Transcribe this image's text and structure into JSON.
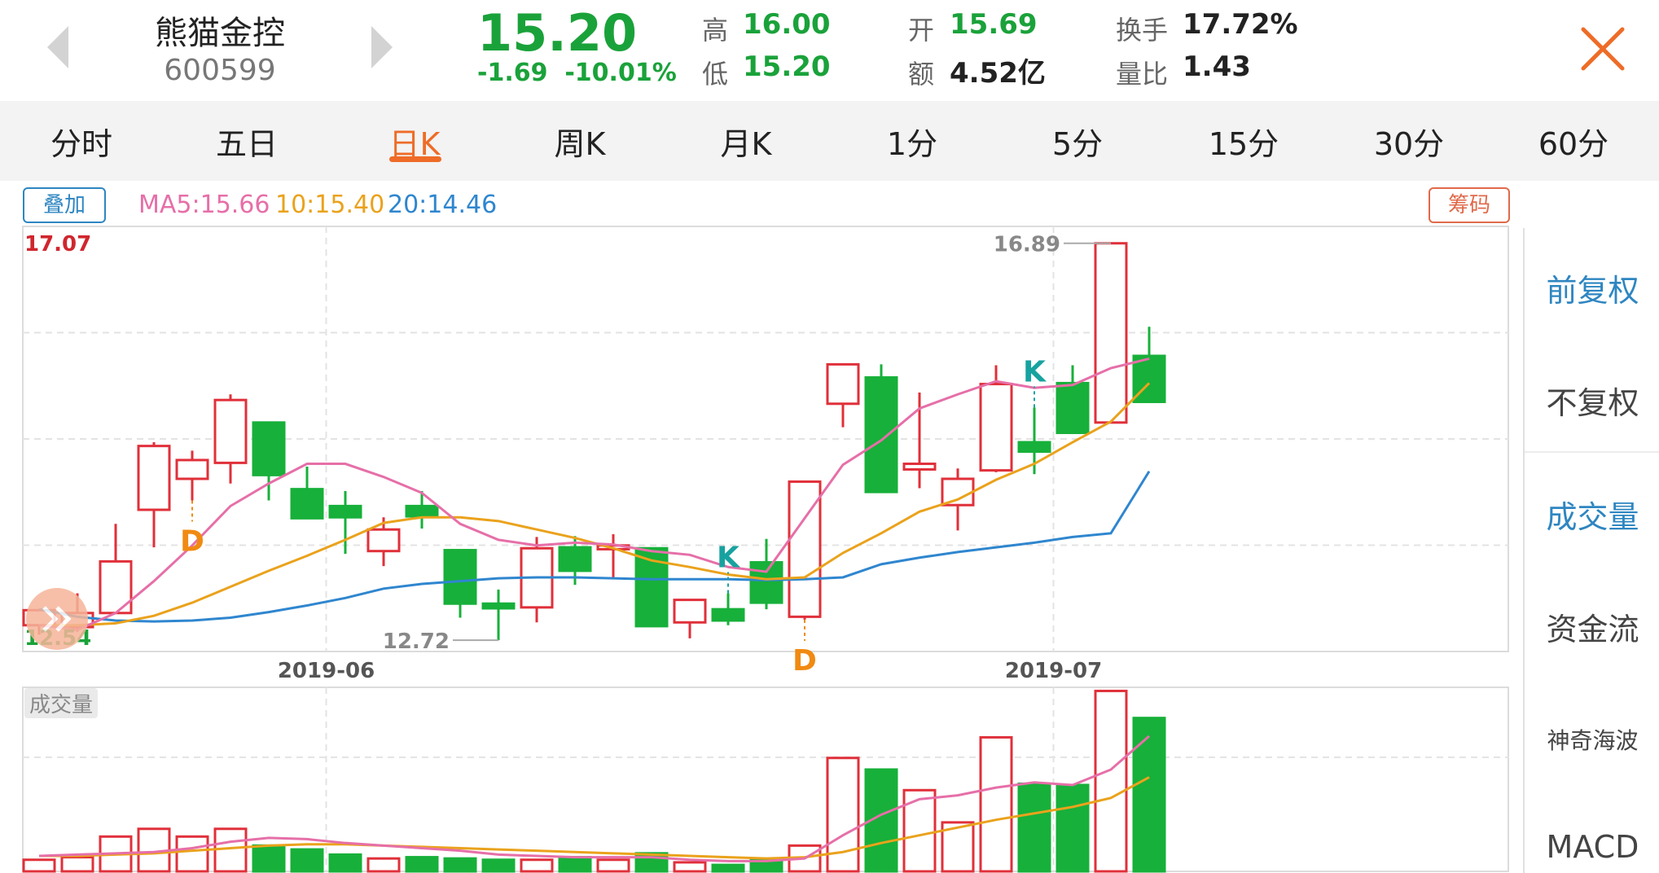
{
  "header": {
    "name": "熊猫金控",
    "code": "600599",
    "price": "15.20",
    "change": "-1.69  -10.01%",
    "quotes": {
      "high_label": "高",
      "high": "16.00",
      "low_label": "低",
      "low": "15.20",
      "open_label": "开",
      "open": "15.69",
      "amount_label": "额",
      "amount": "4.52亿",
      "turnover_label": "换手",
      "turnover": "17.72%",
      "vol_ratio_label": "量比",
      "vol_ratio": "1.43"
    }
  },
  "tabs": [
    "分时",
    "五日",
    "日K",
    "周K",
    "月K",
    "1分",
    "5分",
    "15分",
    "30分",
    "60分"
  ],
  "active_tab": "日K",
  "toolbar": {
    "overlay_label": "叠加",
    "ma5": "MA5:15.66",
    "ma10": "10:15.40",
    "ma20": "20:14.46",
    "chips_label": "筹码"
  },
  "side_panel": [
    "前复权",
    "不复权",
    "成交量",
    "资金流",
    "神奇海波",
    "MACD"
  ],
  "colors": {
    "up": "#e0303a",
    "down": "#17b03a",
    "ma5": "#e66fa8",
    "ma10": "#eaa21c",
    "ma20": "#2f86cf",
    "accent": "#ee6c27",
    "signal_d": "#f08a12",
    "signal_k": "#17a2a0"
  },
  "chart_data": {
    "type": "candlestick",
    "axis_top": "17.07",
    "axis_bottom": "12.54",
    "ylim": [
      12.54,
      17.07
    ],
    "date_labels": [
      "2019-06",
      "2019-07"
    ],
    "date_label_index": [
      8,
      27
    ],
    "max_label": "16.89",
    "min_label": "12.72",
    "volume_label": "成交量",
    "candles": [
      {
        "o": 12.82,
        "h": 12.92,
        "l": 12.72,
        "c": 12.98
      },
      {
        "o": 12.8,
        "h": 13.16,
        "l": 12.75,
        "c": 12.95
      },
      {
        "o": 12.95,
        "h": 13.9,
        "l": 12.95,
        "c": 13.5
      },
      {
        "o": 14.05,
        "h": 14.77,
        "l": 13.65,
        "c": 14.73
      },
      {
        "o": 14.38,
        "h": 14.68,
        "l": 14.15,
        "c": 14.58
      },
      {
        "o": 14.55,
        "h": 15.28,
        "l": 14.33,
        "c": 15.22
      },
      {
        "o": 14.98,
        "h": 14.98,
        "l": 14.15,
        "c": 14.42
      },
      {
        "o": 14.27,
        "h": 14.51,
        "l": 13.95,
        "c": 13.96
      },
      {
        "o": 14.09,
        "h": 14.25,
        "l": 13.58,
        "c": 13.97
      },
      {
        "o": 13.61,
        "h": 13.97,
        "l": 13.45,
        "c": 13.84
      },
      {
        "o": 14.09,
        "h": 14.25,
        "l": 13.85,
        "c": 13.98
      },
      {
        "o": 13.62,
        "h": 13.62,
        "l": 12.9,
        "c": 13.05
      },
      {
        "o": 13.05,
        "h": 13.2,
        "l": 12.66,
        "c": 13.0
      },
      {
        "o": 13.01,
        "h": 13.76,
        "l": 12.85,
        "c": 13.64
      },
      {
        "o": 13.65,
        "h": 13.77,
        "l": 13.25,
        "c": 13.4
      },
      {
        "o": 13.63,
        "h": 13.79,
        "l": 13.33,
        "c": 13.67
      },
      {
        "o": 13.64,
        "h": 13.64,
        "l": 12.81,
        "c": 12.81
      },
      {
        "o": 12.85,
        "h": 13.09,
        "l": 12.68,
        "c": 13.09
      },
      {
        "o": 12.99,
        "h": 13.16,
        "l": 12.82,
        "c": 12.87
      },
      {
        "o": 13.49,
        "h": 13.74,
        "l": 12.99,
        "c": 13.06
      },
      {
        "o": 12.91,
        "h": 14.35,
        "l": 12.88,
        "c": 14.35
      },
      {
        "o": 15.18,
        "h": 15.6,
        "l": 14.93,
        "c": 15.6
      },
      {
        "o": 15.46,
        "h": 15.6,
        "l": 14.23,
        "c": 14.24
      },
      {
        "o": 14.48,
        "h": 15.3,
        "l": 14.28,
        "c": 14.54
      },
      {
        "o": 14.1,
        "h": 14.49,
        "l": 13.83,
        "c": 14.38
      },
      {
        "o": 14.47,
        "h": 15.59,
        "l": 14.45,
        "c": 15.39
      },
      {
        "o": 14.77,
        "h": 15.14,
        "l": 14.43,
        "c": 14.67
      },
      {
        "o": 15.4,
        "h": 15.59,
        "l": 14.98,
        "c": 14.87
      },
      {
        "o": 14.98,
        "h": 16.89,
        "l": 14.98,
        "c": 16.89
      },
      {
        "o": 15.69,
        "h": 16.0,
        "l": 15.2,
        "c": 15.2
      }
    ],
    "ma5": [
      12.82,
      12.77,
      12.95,
      13.29,
      13.67,
      14.09,
      14.33,
      14.54,
      14.54,
      14.4,
      14.23,
      13.9,
      13.73,
      13.67,
      13.7,
      13.68,
      13.61,
      13.57,
      13.44,
      13.39,
      13.96,
      14.53,
      14.79,
      15.13,
      15.28,
      15.42,
      15.35,
      15.38,
      15.56,
      15.66
    ],
    "ma10": [
      12.82,
      12.82,
      12.84,
      12.92,
      13.06,
      13.23,
      13.4,
      13.56,
      13.73,
      13.91,
      13.97,
      13.97,
      13.93,
      13.84,
      13.75,
      13.64,
      13.51,
      13.44,
      13.36,
      13.31,
      13.33,
      13.59,
      13.8,
      14.03,
      14.16,
      14.37,
      14.54,
      14.77,
      14.99,
      15.4
    ],
    "ma20": [
      12.99,
      12.91,
      12.87,
      12.86,
      12.87,
      12.9,
      12.96,
      13.03,
      13.11,
      13.21,
      13.26,
      13.29,
      13.32,
      13.33,
      13.33,
      13.32,
      13.31,
      13.31,
      13.31,
      13.3,
      13.31,
      13.33,
      13.47,
      13.54,
      13.6,
      13.65,
      13.7,
      13.76,
      13.8,
      14.46
    ],
    "volume": [
      9,
      11,
      27,
      33,
      27,
      33,
      20,
      17,
      13,
      10,
      11,
      10,
      9,
      9,
      11,
      9,
      14,
      7,
      5,
      9,
      20,
      88,
      79,
      63,
      38,
      104,
      68,
      67,
      140,
      119
    ],
    "vol_ma5": [
      12,
      13,
      14,
      15,
      18,
      23,
      26,
      25,
      22,
      20,
      18,
      16,
      13,
      12,
      11,
      11,
      11,
      9,
      8,
      8,
      10,
      28,
      44,
      56,
      59,
      65,
      69,
      67,
      79,
      105
    ],
    "vol_ma10": [
      12,
      12,
      13,
      14,
      16,
      18,
      20,
      21,
      21,
      20,
      19,
      18,
      17,
      16,
      15,
      14,
      13,
      12,
      11,
      10,
      11,
      15,
      22,
      28,
      34,
      40,
      45,
      50,
      57,
      73
    ],
    "signals": [
      {
        "index": 4,
        "label": "D",
        "side": "below"
      },
      {
        "index": 18,
        "label": "K",
        "side": "above"
      },
      {
        "index": 20,
        "label": "D",
        "side": "below"
      },
      {
        "index": 26,
        "label": "K",
        "side": "above"
      }
    ]
  }
}
